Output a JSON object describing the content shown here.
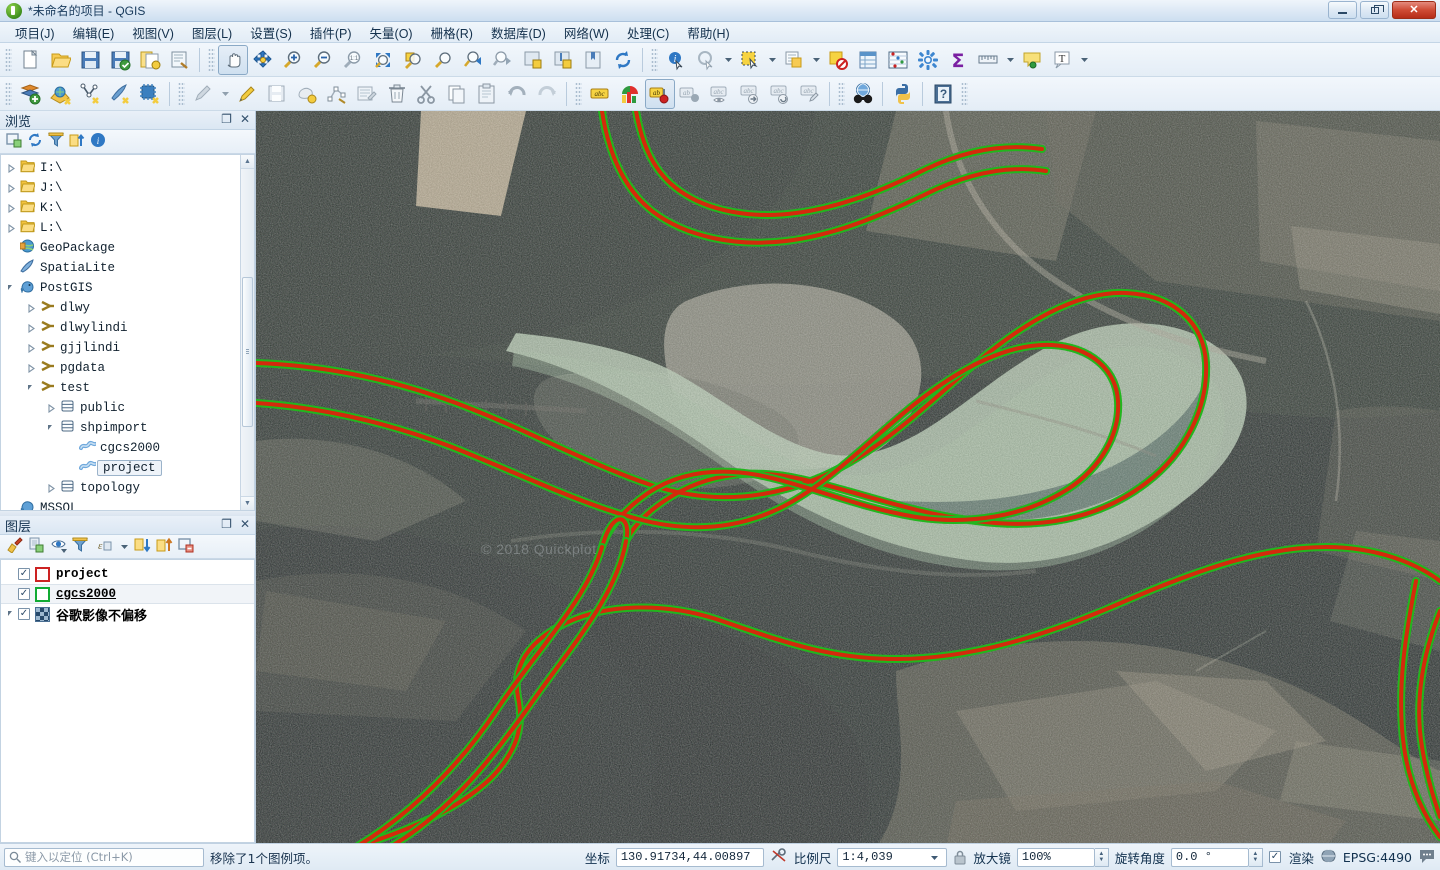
{
  "window": {
    "title": "*未命名的项目 - QGIS",
    "app_icon": "qgis-logo-icon",
    "controls": {
      "minimize": "minimize-button",
      "maximize": "maximize-button",
      "close": "close-button"
    }
  },
  "menubar": {
    "items": [
      {
        "label": "项目(J)"
      },
      {
        "label": "编辑(E)"
      },
      {
        "label": "视图(V)"
      },
      {
        "label": "图层(L)"
      },
      {
        "label": "设置(S)"
      },
      {
        "label": "插件(P)"
      },
      {
        "label": "矢量(O)"
      },
      {
        "label": "栅格(R)"
      },
      {
        "label": "数据库(D)"
      },
      {
        "label": "网络(W)"
      },
      {
        "label": "处理(C)"
      },
      {
        "label": "帮助(H)"
      }
    ]
  },
  "toolbars": {
    "row1": [
      "new-project-icon",
      "open-project-icon",
      "save-project-icon",
      "save-project-as-icon",
      "new-print-layout-icon",
      "style-manager-icon",
      "pan-map-icon",
      "pan-to-selection-icon",
      "zoom-in-icon",
      "zoom-out-icon",
      "zoom-native-icon",
      "zoom-full-icon",
      "zoom-to-selection-icon",
      "zoom-to-layer-icon",
      "zoom-last-icon",
      "zoom-next-icon",
      "new-map-view-icon",
      "new-3d-map-view-icon",
      "show-bookmarks-icon",
      "refresh-icon",
      "identify-features-icon",
      "run-feature-action-icon",
      "select-features-icon",
      "deselect-icon",
      "select-value-icon",
      "open-attribute-table-icon",
      "field-calculator-icon",
      "options-icon",
      "statistical-summary-icon",
      "measure-line-icon",
      "map-tips-icon",
      "text-annotation-icon"
    ],
    "row2": [
      "add-vector-layer-icon",
      "add-raster-layer-icon",
      "add-delimited-text-icon",
      "add-spatialite-layer-icon",
      "add-postgis-layer-icon",
      "current-edits-icon",
      "toggle-editing-icon",
      "save-layer-edits-icon",
      "add-feature-icon",
      "vertex-tool-icon",
      "modify-attributes-icon",
      "delete-selected-icon",
      "cut-features-icon",
      "copy-features-icon",
      "paste-features-icon",
      "undo-icon",
      "redo-icon",
      "label-icon",
      "styling-icon",
      "pin-labels-icon",
      "show-hide-labels-icon",
      "highlight-labels-icon",
      "move-label-icon",
      "rotate-label-icon",
      "change-label-icon",
      "metasearch-icon",
      "python-console-icon",
      "help-icon"
    ]
  },
  "browser_panel": {
    "title": "浏览",
    "tools": [
      "add-layer-icon",
      "refresh-icon",
      "filter-icon",
      "collapse-all-icon",
      "properties-icon"
    ],
    "header_buttons": [
      "undock-icon",
      "close-icon"
    ],
    "tree": [
      {
        "label": "I:\\",
        "indent": 0,
        "expander": "collapsed",
        "icon": "folder-icon"
      },
      {
        "label": "J:\\",
        "indent": 0,
        "expander": "collapsed",
        "icon": "folder-icon"
      },
      {
        "label": "K:\\",
        "indent": 0,
        "expander": "collapsed",
        "icon": "folder-icon"
      },
      {
        "label": "L:\\",
        "indent": 0,
        "expander": "collapsed",
        "icon": "folder-icon"
      },
      {
        "label": "GeoPackage",
        "indent": 0,
        "expander": "none",
        "icon": "geopackage-icon"
      },
      {
        "label": "SpatiaLite",
        "indent": 0,
        "expander": "none",
        "icon": "spatialite-icon"
      },
      {
        "label": "PostGIS",
        "indent": 0,
        "expander": "expanded",
        "icon": "postgis-elephant-icon"
      },
      {
        "label": "dlwy",
        "indent": 1,
        "expander": "collapsed",
        "icon": "pg-connection-icon"
      },
      {
        "label": "dlwylindi",
        "indent": 1,
        "expander": "collapsed",
        "icon": "pg-connection-icon"
      },
      {
        "label": "gjjlindi",
        "indent": 1,
        "expander": "collapsed",
        "icon": "pg-connection-icon"
      },
      {
        "label": "pgdata",
        "indent": 1,
        "expander": "collapsed",
        "icon": "pg-connection-icon"
      },
      {
        "label": "test",
        "indent": 1,
        "expander": "expanded",
        "icon": "pg-connection-icon"
      },
      {
        "label": "public",
        "indent": 2,
        "expander": "collapsed",
        "icon": "schema-icon"
      },
      {
        "label": "shpimport",
        "indent": 2,
        "expander": "expanded",
        "icon": "schema-icon"
      },
      {
        "label": "cgcs2000",
        "indent": 3,
        "expander": "none",
        "icon": "polyline-layer-icon"
      },
      {
        "label": "project",
        "indent": 3,
        "expander": "none",
        "icon": "polyline-layer-icon",
        "selected": true
      },
      {
        "label": "topology",
        "indent": 2,
        "expander": "collapsed",
        "icon": "schema-icon"
      },
      {
        "label": "MSSQL",
        "indent": 0,
        "expander": "none",
        "icon": "mssql-icon"
      }
    ],
    "scroll": {
      "up_arrow": "scroll-up-icon",
      "down_arrow": "scroll-down-icon"
    }
  },
  "layers_panel": {
    "title": "图层",
    "header_buttons": [
      "undock-icon",
      "close-icon"
    ],
    "tools": [
      "open-layer-styling-icon",
      "add-group-icon",
      "manage-visibility-icon",
      "filter-legend-icon",
      "filter-expression-icon",
      "expand-all-icon",
      "collapse-all-icon",
      "remove-layer-icon"
    ],
    "layers": [
      {
        "name": "project",
        "checked": true,
        "symbol": "outline-red-square",
        "style": "bold",
        "expander": false
      },
      {
        "name": "cgcs2000",
        "checked": true,
        "symbol": "outline-green-square",
        "style": "bold-underline",
        "expander": false,
        "highlighted": true
      },
      {
        "name": "谷歌影像不偏移",
        "checked": true,
        "symbol": "raster-checker",
        "style": "bold-cjk",
        "expander": true
      }
    ]
  },
  "map": {
    "attribution": "© 2018 Quickplot",
    "layer_colors": {
      "halo_green": "#22b61e",
      "line_red": "#d42a0c",
      "water": "#c5d9c0"
    }
  },
  "statusbar": {
    "locator_placeholder": "键入以定位 (Ctrl+K)",
    "locator_icon": "search-icon",
    "message": "移除了1个图例项。",
    "coordinate_label": "坐标",
    "coordinate_value": "130.91734,44.00897",
    "coordinate_toggle_icon": "toggle-extents-icon",
    "scale_label": "比例尺",
    "scale_value": "1:4,039",
    "scale_lock_icon": "lock-icon",
    "magnifier_label": "放大镜",
    "magnifier_value": "100%",
    "rotation_label": "旋转角度",
    "rotation_value": "0.0 °",
    "render_label": "渲染",
    "render_checked": true,
    "crs_label": "EPSG:4490",
    "crs_icon": "crs-globe-icon",
    "messages_icon": "message-log-icon"
  }
}
